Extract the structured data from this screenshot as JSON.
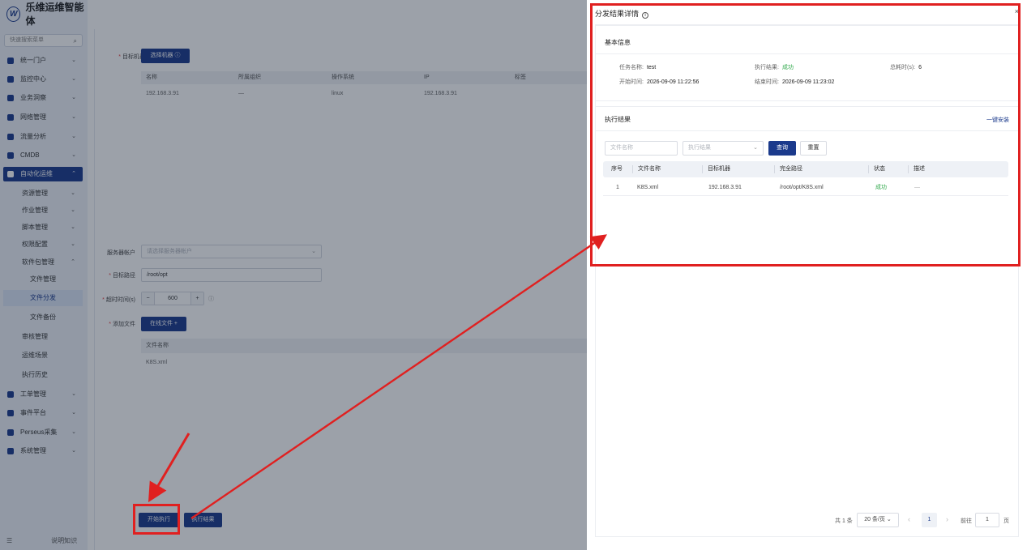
{
  "app": {
    "brand_logo": "W",
    "brand_name": "乐维运维智能体",
    "search_placeholder": "快速搜索菜单",
    "footer_label": "说明知识"
  },
  "sidebar": {
    "items": [
      {
        "label": "统一门户"
      },
      {
        "label": "监控中心"
      },
      {
        "label": "业务洞察"
      },
      {
        "label": "网络管理"
      },
      {
        "label": "流量分析"
      },
      {
        "label": "CMDB"
      },
      {
        "label": "自动化运维"
      },
      {
        "label": "工单管理"
      },
      {
        "label": "事件平台"
      },
      {
        "label": "Perseus采集"
      },
      {
        "label": "系统管理"
      }
    ],
    "sub_items": [
      {
        "label": "资源管理"
      },
      {
        "label": "作业管理"
      },
      {
        "label": "脚本管理"
      },
      {
        "label": "权限配置"
      },
      {
        "label": "软件包管理"
      },
      {
        "label": "审核管理"
      },
      {
        "label": "运维场景"
      },
      {
        "label": "执行历史"
      }
    ],
    "sub2_items": [
      {
        "label": "文件管理"
      },
      {
        "label": "文件分发"
      },
      {
        "label": "文件备份"
      }
    ]
  },
  "form": {
    "target_label": "目标机器",
    "select_machine_btn": "选择机器",
    "machine_table": {
      "headers": [
        "名称",
        "所属组织",
        "操作系统",
        "IP",
        "标签"
      ],
      "row": [
        "192.168.3.91",
        "—",
        "linux",
        "192.168.3.91",
        ""
      ]
    },
    "service_account_label": "服务器帐户",
    "service_account_placeholder": "请选择服务器帐户",
    "target_path_label": "目标路径",
    "target_path_value": "/root/opt",
    "timeout_label": "超时时间(s)",
    "timeout_value": "600",
    "add_file_label": "添加文件",
    "online_file_btn": "在线文件",
    "file_table_header": "文件名称",
    "file_table_row": "K8S.xml",
    "start_btn": "开始执行",
    "result_btn": "执行结果"
  },
  "drawer": {
    "title": "分发结果详情",
    "basic_section": "基本信息",
    "task_name_label": "任务名称:",
    "task_name_value": "test",
    "exec_result_label": "执行结果:",
    "exec_result_value": "成功",
    "duration_label": "总耗时(s):",
    "duration_value": "6",
    "start_time_label": "开始时间:",
    "start_time_value": "2026-09-09 11:22:56",
    "end_time_label": "结束时间:",
    "end_time_value": "2026-09-09 11:23:02",
    "result_section": "执行结果",
    "install_link": "一键安装",
    "filter_filename_placeholder": "文件名称",
    "filter_result_placeholder": "执行结果",
    "query_btn": "查询",
    "reset_btn": "重置",
    "table_headers": [
      "序号",
      "文件名称",
      "目标机器",
      "完全路径",
      "状态",
      "描述"
    ],
    "table_row": [
      "1",
      "K8S.xml",
      "192.168.3.91",
      "/root/opt/K8S.xml",
      "成功",
      "—"
    ],
    "pager_total": "共 1 条",
    "pager_size": "20 条/页",
    "pager_page": "1",
    "pager_goto": "前往",
    "pager_goto_value": "1",
    "pager_unit": "页"
  },
  "colors": {
    "brand": "#1b3a8c",
    "success": "#2ea84a",
    "annotation": "#e02020"
  }
}
